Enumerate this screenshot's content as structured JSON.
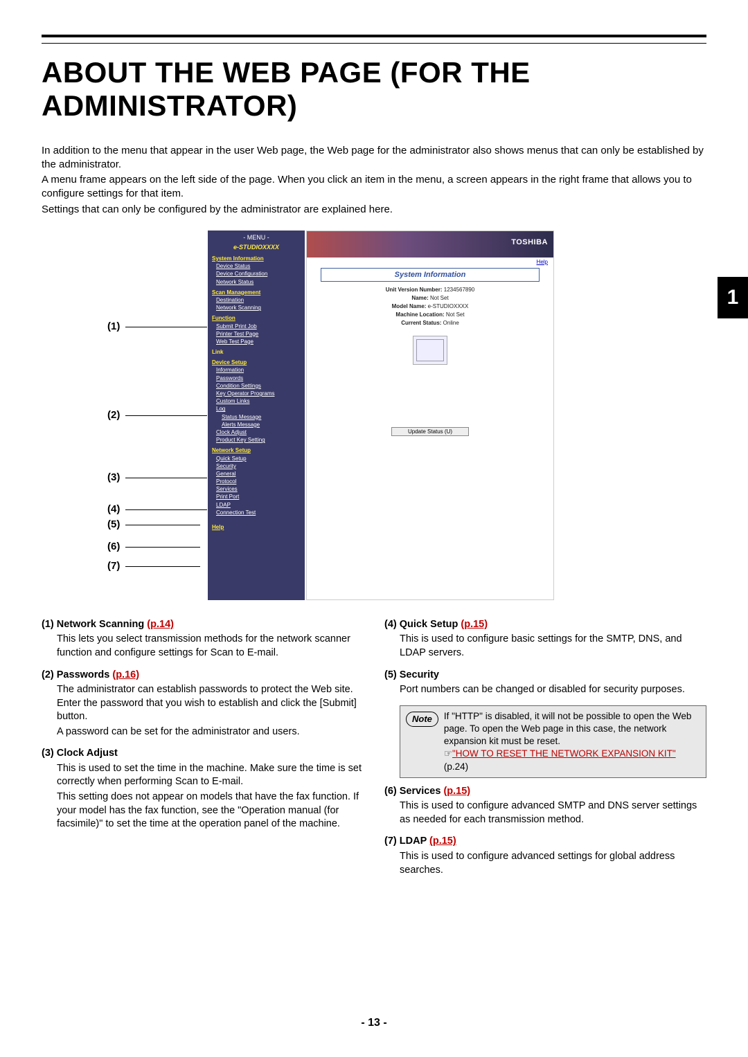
{
  "title": "ABOUT THE WEB PAGE (FOR THE ADMINISTRATOR)",
  "intro": [
    "In addition to the menu that appear in the user Web page, the Web page for the administrator also shows menus that can only be established by the administrator.",
    "A menu frame appears on the left side of the page. When you click an item in the menu, a screen appears in the right frame that allows you to configure settings for that item.",
    "Settings that can only be configured by the administrator are explained here."
  ],
  "chapter_tab": "1",
  "callouts": [
    "(1)",
    "(2)",
    "(3)",
    "(4)",
    "(5)",
    "(6)",
    "(7)"
  ],
  "menu": {
    "title": "- MENU -",
    "device": "e-STUDIOXXXX",
    "sections": [
      {
        "head": "System Information",
        "items": [
          "Device Status",
          "Device Configuration",
          "Network Status"
        ]
      },
      {
        "head": "Scan Management",
        "items": [
          "Destination",
          "Network Scanning"
        ]
      },
      {
        "head": "Function",
        "items": [
          "Submit Print Job",
          "Printer Test Page",
          "Web Test Page"
        ]
      },
      {
        "head": "Link",
        "items": []
      },
      {
        "head": "Device Setup",
        "items": [
          "Information",
          "Passwords",
          "Condition Settings",
          "Key Operator Programs",
          "Custom Links",
          "Log"
        ],
        "subitems": [
          "Status Message",
          "Alerts Message"
        ],
        "items2": [
          "Clock Adjust",
          "Product Key Setting"
        ]
      },
      {
        "head": "Network Setup",
        "items": [
          "Quick Setup",
          "Security",
          "General",
          "Protocol",
          "Services",
          "Print Port",
          "LDAP",
          "Connection Test"
        ]
      },
      {
        "head": "Help",
        "items": []
      }
    ]
  },
  "content": {
    "brand": "TOSHIBA",
    "help": "Help",
    "box_title": "System Information",
    "info": [
      {
        "label": "Unit Version Number:",
        "value": "1234567890"
      },
      {
        "label": "Name:",
        "value": "Not Set"
      },
      {
        "label": "Model Name:",
        "value": "e-STUDIOXXXX"
      },
      {
        "label": "Machine Location:",
        "value": "Not Set"
      },
      {
        "label": "Current Status:",
        "value": "Online"
      }
    ],
    "update_btn": "Update Status (U)"
  },
  "left_col": [
    {
      "n": "(1)",
      "title": "Network Scanning",
      "ref": "(p.14)",
      "body": [
        "This lets you select transmission methods for the network scanner function and configure settings for Scan to E-mail."
      ]
    },
    {
      "n": "(2)",
      "title": "Passwords",
      "ref": "(p.16)",
      "body": [
        "The administrator can establish passwords to protect the Web site. Enter the password that you wish to establish and click the [Submit] button.",
        "A password can be set for the administrator and users."
      ]
    },
    {
      "n": "(3)",
      "title": "Clock Adjust",
      "ref": "",
      "body": [
        "This is used to set the time in the machine. Make sure the time is set correctly when performing Scan to E-mail.",
        "This setting does not appear on models that have the fax function. If your model has the fax function, see the \"Operation manual (for facsimile)\" to set the time at the operation panel of the machine."
      ]
    }
  ],
  "right_col": [
    {
      "n": "(4)",
      "title": "Quick Setup",
      "ref": "(p.15)",
      "body": [
        "This is used to configure basic settings for the SMTP, DNS, and LDAP servers."
      ]
    },
    {
      "n": "(5)",
      "title": "Security",
      "ref": "",
      "body": [
        "Port numbers can be changed or disabled for security purposes."
      ]
    },
    {
      "n": "(6)",
      "title": "Services",
      "ref": "(p.15)",
      "body": [
        "This is used to configure advanced SMTP and DNS server settings as needed for each transmission method."
      ]
    },
    {
      "n": "(7)",
      "title": "LDAP",
      "ref": "(p.15)",
      "body": [
        "This is used to configure advanced settings for global address searches."
      ]
    }
  ],
  "note": {
    "label": "Note",
    "text_pre": "If \"HTTP\" is disabled, it will not be possible to open the Web page. To open the Web page in this case, the network expansion kit must be reset.",
    "pointer": "☞",
    "link": "\"HOW TO RESET THE NETWORK EXPANSION KIT\"",
    "link_suffix": " (p.24)"
  },
  "page_number": "- 13 -"
}
